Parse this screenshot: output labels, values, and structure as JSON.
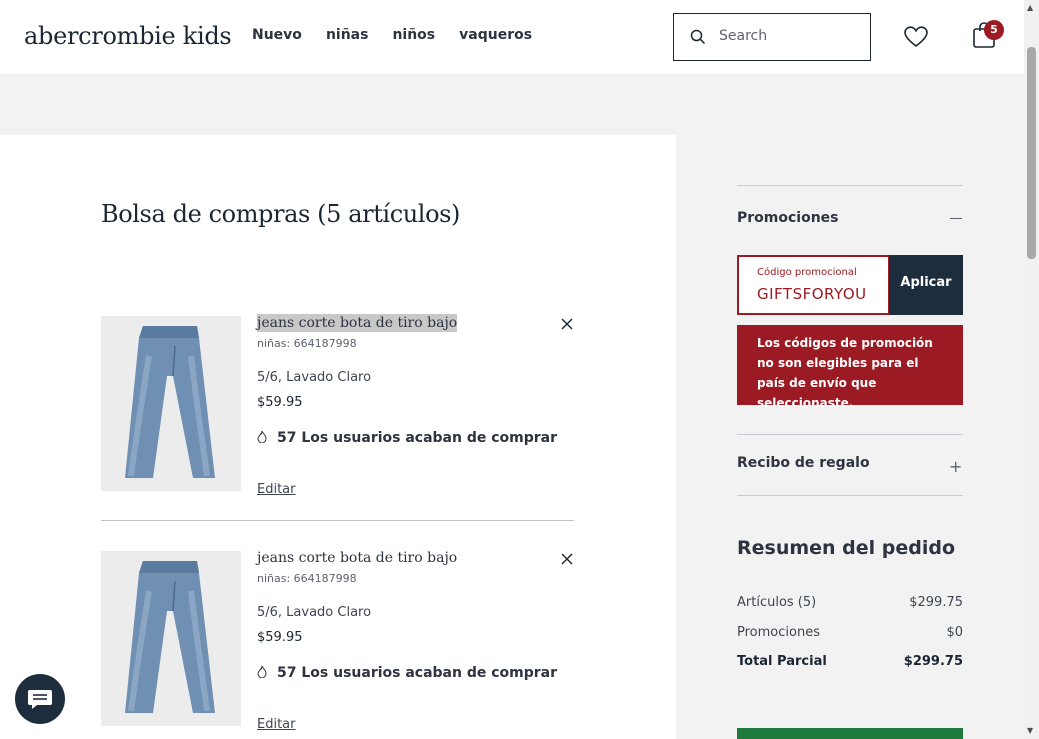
{
  "header": {
    "logo": "abercrombie kids",
    "nav": [
      "Nuevo",
      "niñas",
      "niños",
      "vaqueros"
    ],
    "search_placeholder": "Search",
    "bag_count": "5"
  },
  "cart": {
    "title": "Bolsa de compras (5 artículos)",
    "items": [
      {
        "name": "jeans corte bota de tiro bajo",
        "sku": "niñas: 664187998",
        "variant": "5/6, Lavado Claro",
        "price": "$59.95",
        "urgency": "57 Los usuarios acaban de comprar",
        "edit": "Editar"
      },
      {
        "name": "jeans corte bota de tiro bajo",
        "sku": "niñas: 664187998",
        "variant": "5/6, Lavado Claro",
        "price": "$59.95",
        "urgency": "57 Los usuarios acaban de comprar",
        "edit": "Editar"
      }
    ]
  },
  "sidebar": {
    "promotions_label": "Promociones",
    "promo_code_label": "Código promocional",
    "promo_code_value": "GIFTSFORYOU",
    "apply_label": "Aplicar",
    "error_message": "Los códigos de promoción no son elegibles para el país de envío que seleccionaste.",
    "gift_receipt_label": "Recibo de regalo",
    "summary_title": "Resumen del pedido",
    "summary": [
      {
        "label": "Artículos (5)",
        "value": "$299.75"
      },
      {
        "label": "Promociones",
        "value": "$0"
      },
      {
        "label": "Total Parcial",
        "value": "$299.75"
      }
    ]
  },
  "colors": {
    "brand_navy": "#1e2d3d",
    "error_red": "#9b1a23",
    "checkout_green": "#1f7a3e"
  }
}
